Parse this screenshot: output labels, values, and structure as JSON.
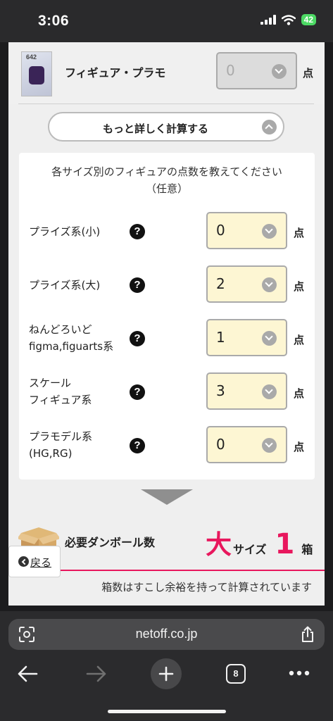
{
  "status": {
    "time": "3:06",
    "battery": "42"
  },
  "product": {
    "label": "フィギュア・プラモ",
    "value": "0",
    "unit": "点",
    "image_text": "642"
  },
  "more_button": {
    "label": "もっと詳しく計算する"
  },
  "instructions": {
    "line1": "各サイズ別のフィギュアの点数を教えてください",
    "line2": "（任意）"
  },
  "rows": [
    {
      "label_line1": "プライズ系(小)",
      "label_line2": "",
      "value": "0",
      "unit": "点"
    },
    {
      "label_line1": "プライズ系(大)",
      "label_line2": "",
      "value": "2",
      "unit": "点"
    },
    {
      "label_line1": "ねんどろいど",
      "label_line2": "figma,figuarts系",
      "value": "1",
      "unit": "点"
    },
    {
      "label_line1": "スケール",
      "label_line2": "フィギュア系",
      "value": "3",
      "unit": "点"
    },
    {
      "label_line1": "プラモデル系",
      "label_line2": "(HG,RG)",
      "value": "0",
      "unit": "点"
    }
  ],
  "help_glyph": "?",
  "result": {
    "label": "必要ダンボール数",
    "size": "大",
    "size_word": "サイズ",
    "count": "1",
    "count_unit": "箱",
    "note": "箱数はすこし余裕を持って計算されています"
  },
  "back_button": {
    "label": "戻る"
  },
  "browser": {
    "url": "netoff.co.jp",
    "tab_count": "8"
  },
  "colors": {
    "accent": "#e8175d",
    "select_bg": "#fdf6d3",
    "battery": "#4cd964"
  },
  "icons": [
    "signal-icon",
    "wifi-icon",
    "battery-icon",
    "question-icon",
    "chevron-down-icon",
    "chevron-up-icon",
    "box-icon",
    "back-arrow-icon",
    "page-settings-icon",
    "share-icon",
    "back-nav-icon",
    "forward-nav-icon",
    "new-tab-icon",
    "tabs-icon",
    "more-icon"
  ]
}
